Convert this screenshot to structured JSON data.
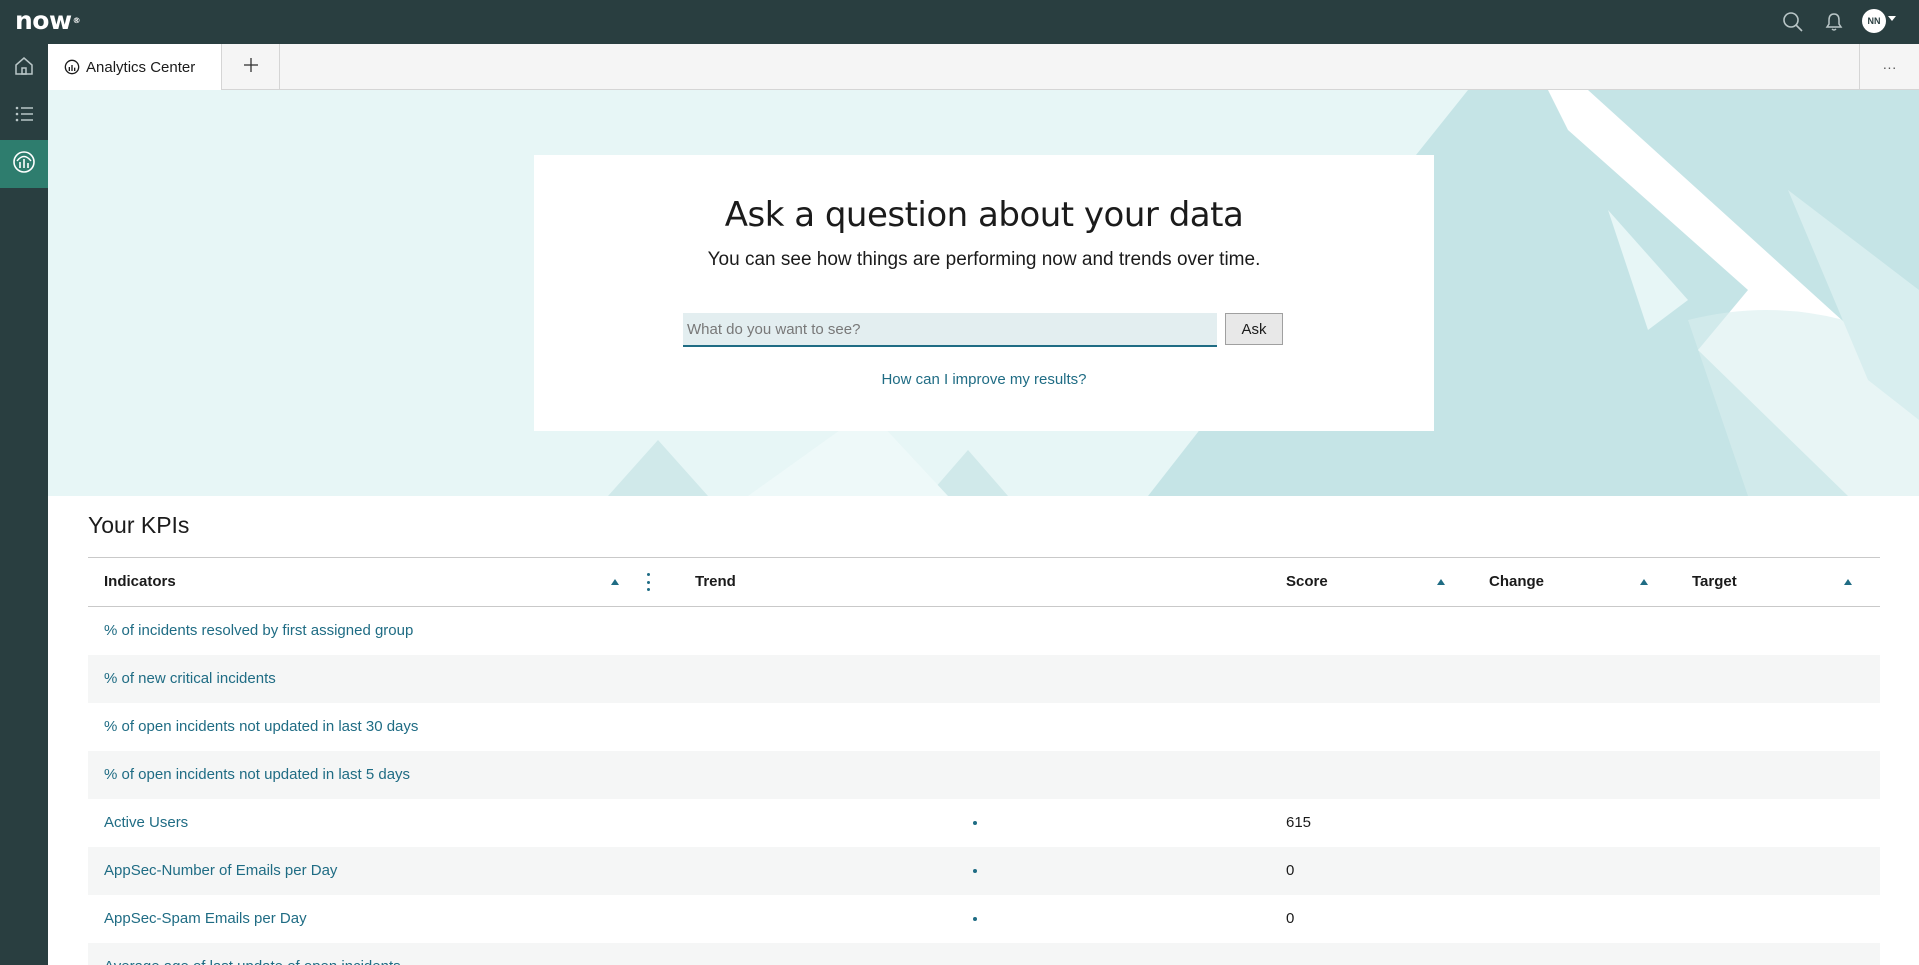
{
  "header": {
    "logo_text": "now",
    "logo_mark": "®",
    "avatar_initials": "NN",
    "icons": [
      "search-icon",
      "bell-icon",
      "chevron-down-icon"
    ]
  },
  "leftnav": {
    "items": [
      "home-icon",
      "list-icon",
      "analytics-icon"
    ],
    "active": "analytics-icon"
  },
  "tabs": {
    "items": [
      {
        "label": "Analytics Center",
        "icon": "analytics-icon"
      }
    ],
    "add_icon": "plus-icon",
    "more_label": "···"
  },
  "ask": {
    "title": "Ask a question about your data",
    "subtitle": "You can see how things are performing now and trends over time.",
    "placeholder": "What do you want to see?",
    "value": "",
    "button_label": "Ask",
    "help_link": "How can I improve my results?"
  },
  "kpis": {
    "title": "Your KPIs",
    "columns": {
      "indicators": "Indicators",
      "trend": "Trend",
      "score": "Score",
      "change": "Change",
      "target": "Target"
    },
    "rows": [
      {
        "indicator": "% of incidents resolved by first assigned group",
        "score": ""
      },
      {
        "indicator": "% of new critical incidents",
        "score": ""
      },
      {
        "indicator": "% of open incidents not updated in last 30 days",
        "score": ""
      },
      {
        "indicator": "% of open incidents not updated in last 5 days",
        "score": ""
      },
      {
        "indicator": "Active Users",
        "score": "615"
      },
      {
        "indicator": "AppSec-Number of Emails per Day",
        "score": "0"
      },
      {
        "indicator": "AppSec-Spam Emails per Day",
        "score": "0"
      },
      {
        "indicator": "Average age of last update of open incidents",
        "score": ""
      }
    ]
  },
  "colors": {
    "header_bg": "#293e40",
    "nav_active": "#2e7d6e",
    "hero_bg": "#e7f6f6",
    "hero_shape": "#c8e6e8",
    "link": "#1f6c84"
  }
}
